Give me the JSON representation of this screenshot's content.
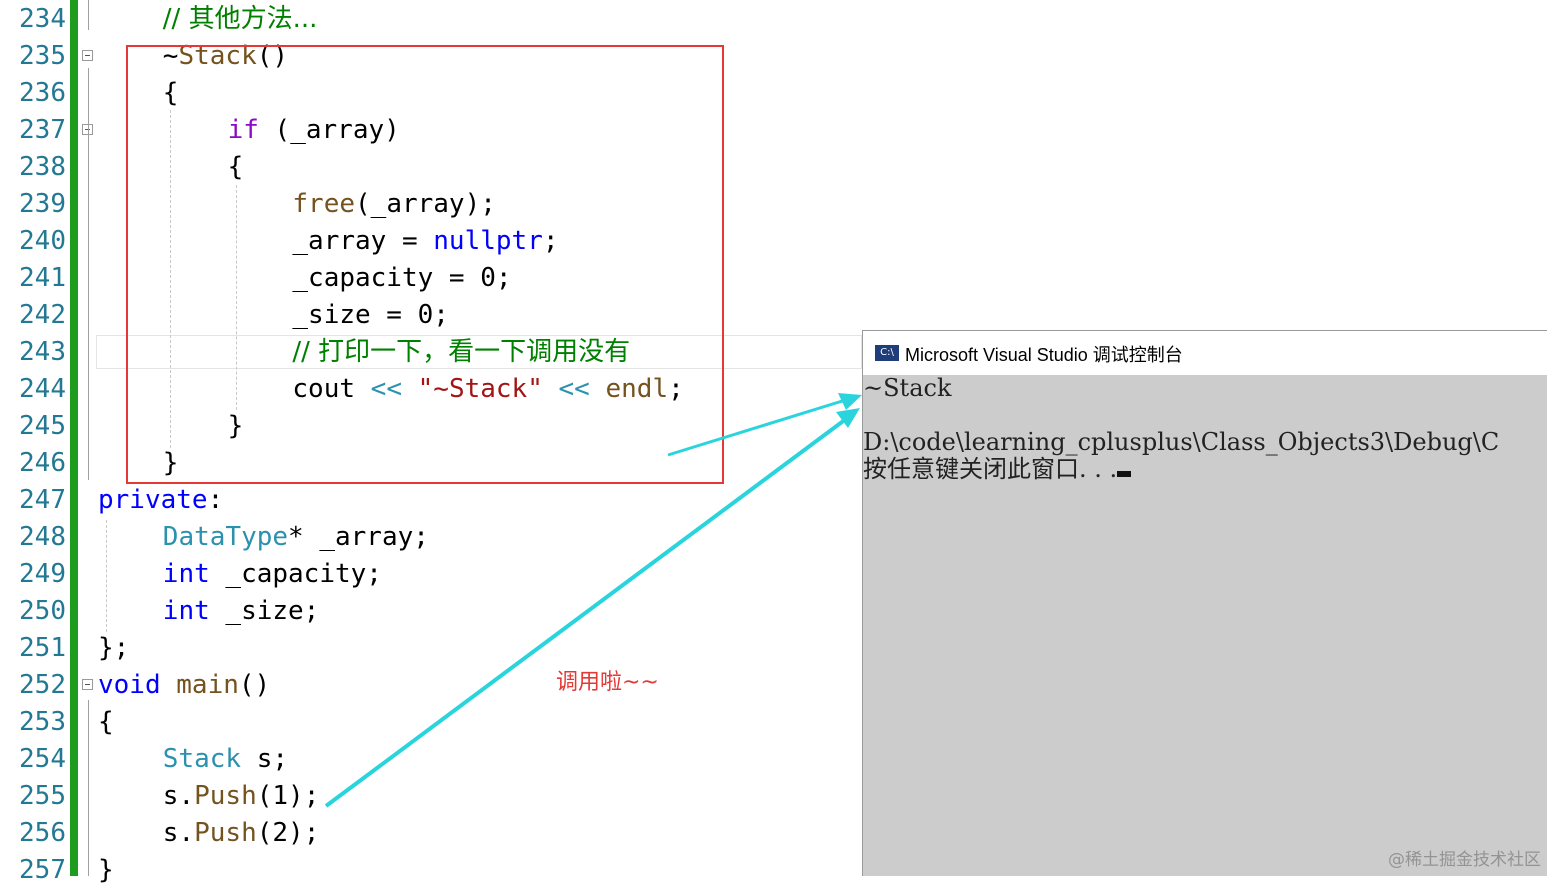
{
  "lines": [
    {
      "n": "234",
      "indent": 2,
      "fold": false,
      "tokens": [
        {
          "c": "cm",
          "t": "// 其他方法..."
        }
      ]
    },
    {
      "n": "235",
      "indent": 2,
      "fold": true,
      "tokens": [
        {
          "c": "",
          "t": "~"
        },
        {
          "c": "fn",
          "t": "Stack"
        },
        {
          "c": "",
          "t": "()"
        }
      ]
    },
    {
      "n": "236",
      "indent": 2,
      "fold": false,
      "tokens": [
        {
          "c": "",
          "t": "{"
        }
      ]
    },
    {
      "n": "237",
      "indent": 4,
      "fold": true,
      "tokens": [
        {
          "c": "kwp",
          "t": "if"
        },
        {
          "c": "",
          "t": " (_array)"
        }
      ]
    },
    {
      "n": "238",
      "indent": 4,
      "fold": false,
      "tokens": [
        {
          "c": "",
          "t": "{"
        }
      ]
    },
    {
      "n": "239",
      "indent": 6,
      "fold": false,
      "tokens": [
        {
          "c": "fn",
          "t": "free"
        },
        {
          "c": "",
          "t": "(_array);"
        }
      ]
    },
    {
      "n": "240",
      "indent": 6,
      "fold": false,
      "tokens": [
        {
          "c": "",
          "t": "_array = "
        },
        {
          "c": "kw",
          "t": "nullptr"
        },
        {
          "c": "",
          "t": ";"
        }
      ]
    },
    {
      "n": "241",
      "indent": 6,
      "fold": false,
      "tokens": [
        {
          "c": "",
          "t": "_capacity = 0;"
        }
      ]
    },
    {
      "n": "242",
      "indent": 6,
      "fold": false,
      "tokens": [
        {
          "c": "",
          "t": "_size = 0;"
        }
      ]
    },
    {
      "n": "243",
      "indent": 6,
      "fold": false,
      "tokens": [
        {
          "c": "cm",
          "t": "// 打印一下，看一下调用没有"
        }
      ]
    },
    {
      "n": "244",
      "indent": 6,
      "fold": false,
      "tokens": [
        {
          "c": "",
          "t": "cout "
        },
        {
          "c": "ty",
          "t": "<<"
        },
        {
          "c": "",
          "t": " "
        },
        {
          "c": "st",
          "t": "\"~Stack\""
        },
        {
          "c": "",
          "t": " "
        },
        {
          "c": "ty",
          "t": "<<"
        },
        {
          "c": "",
          "t": " "
        },
        {
          "c": "fn",
          "t": "endl"
        },
        {
          "c": "",
          "t": ";"
        }
      ]
    },
    {
      "n": "245",
      "indent": 4,
      "fold": false,
      "tokens": [
        {
          "c": "",
          "t": "}"
        }
      ]
    },
    {
      "n": "246",
      "indent": 2,
      "fold": false,
      "tokens": [
        {
          "c": "",
          "t": "}"
        }
      ]
    },
    {
      "n": "247",
      "indent": 0,
      "fold": false,
      "tokens": [
        {
          "c": "kw",
          "t": "private"
        },
        {
          "c": "",
          "t": ":"
        }
      ]
    },
    {
      "n": "248",
      "indent": 2,
      "fold": false,
      "tokens": [
        {
          "c": "ty",
          "t": "DataType"
        },
        {
          "c": "",
          "t": "* _array;"
        }
      ]
    },
    {
      "n": "249",
      "indent": 2,
      "fold": false,
      "tokens": [
        {
          "c": "kw",
          "t": "int"
        },
        {
          "c": "",
          "t": " _capacity;"
        }
      ]
    },
    {
      "n": "250",
      "indent": 2,
      "fold": false,
      "tokens": [
        {
          "c": "kw",
          "t": "int"
        },
        {
          "c": "",
          "t": " _size;"
        }
      ]
    },
    {
      "n": "251",
      "indent": 0,
      "fold": false,
      "tokens": [
        {
          "c": "",
          "t": "};"
        }
      ]
    },
    {
      "n": "252",
      "indent": 0,
      "fold": true,
      "tokens": [
        {
          "c": "kw",
          "t": "void"
        },
        {
          "c": "",
          "t": " "
        },
        {
          "c": "fn",
          "t": "main"
        },
        {
          "c": "",
          "t": "()"
        }
      ]
    },
    {
      "n": "253",
      "indent": 0,
      "fold": false,
      "tokens": [
        {
          "c": "",
          "t": "{"
        }
      ]
    },
    {
      "n": "254",
      "indent": 2,
      "fold": false,
      "tokens": [
        {
          "c": "ty",
          "t": "Stack"
        },
        {
          "c": "",
          "t": " s;"
        }
      ]
    },
    {
      "n": "255",
      "indent": 2,
      "fold": false,
      "tokens": [
        {
          "c": "",
          "t": "s."
        },
        {
          "c": "fn",
          "t": "Push"
        },
        {
          "c": "",
          "t": "(1);"
        }
      ]
    },
    {
      "n": "256",
      "indent": 2,
      "fold": false,
      "tokens": [
        {
          "c": "",
          "t": "s."
        },
        {
          "c": "fn",
          "t": "Push"
        },
        {
          "c": "",
          "t": "(2);"
        }
      ]
    },
    {
      "n": "257",
      "indent": 0,
      "fold": false,
      "tokens": [
        {
          "c": "",
          "t": "}"
        }
      ]
    }
  ],
  "console": {
    "title": "Microsoft Visual Studio 调试控制台",
    "icon": "console-app-icon",
    "icon_text": "C:\\",
    "output": [
      "~Stack",
      "",
      "D:\\code\\learning_cplusplus\\Class_Objects3\\Debug\\C",
      "按任意键关闭此窗口. . ."
    ]
  },
  "annotation": "调用啦~~",
  "watermark": "@稀土掘金技术社区",
  "colors": {
    "gutter_bar": "#1e9c1e",
    "highlight_box": "#e53935",
    "arrow": "#2ad4dc",
    "console_bg": "#cccccc"
  }
}
